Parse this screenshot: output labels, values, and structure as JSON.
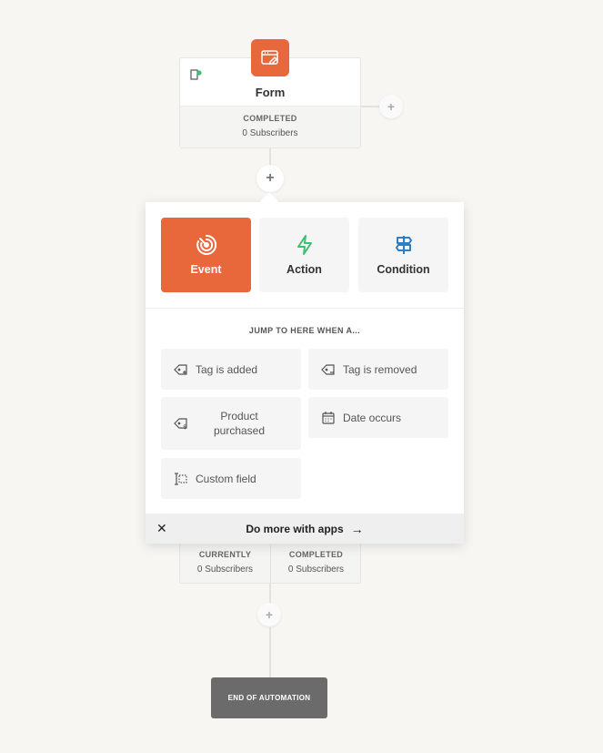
{
  "form_node": {
    "title": "Form",
    "stat_label": "COMPLETED",
    "stat_value": "0 Subscribers",
    "icon": "browser-edit-icon",
    "mini_icon": "form-status-icon"
  },
  "add_step_icon": "+",
  "panel": {
    "types": [
      {
        "label": "Event",
        "icon": "target-icon",
        "active": true
      },
      {
        "label": "Action",
        "icon": "lightning-icon",
        "active": false
      },
      {
        "label": "Condition",
        "icon": "signpost-icon",
        "active": false
      }
    ],
    "jump_title": "JUMP TO HERE WHEN A...",
    "options": [
      {
        "label": "Tag is added",
        "icon": "tag-plus-icon"
      },
      {
        "label": "Tag is removed",
        "icon": "tag-minus-icon"
      },
      {
        "label": "Product purchased",
        "icon": "tag-dollar-icon"
      },
      {
        "label": "Date occurs",
        "icon": "calendar-icon"
      },
      {
        "label": "Custom field",
        "icon": "text-field-icon"
      }
    ],
    "footer": {
      "close": "✕",
      "label": "Do more with apps",
      "arrow": "→"
    }
  },
  "stats_node": {
    "currently_label": "CURRENTLY",
    "currently_value": "0 Subscribers",
    "completed_label": "COMPLETED",
    "completed_value": "0 Subscribers"
  },
  "end_label": "END OF AUTOMATION",
  "colors": {
    "accent": "#e8673b",
    "action_icon": "#3cc173",
    "condition_icon": "#2b7fc9",
    "end_box": "#6b6b6b",
    "background": "#f7f6f3"
  }
}
